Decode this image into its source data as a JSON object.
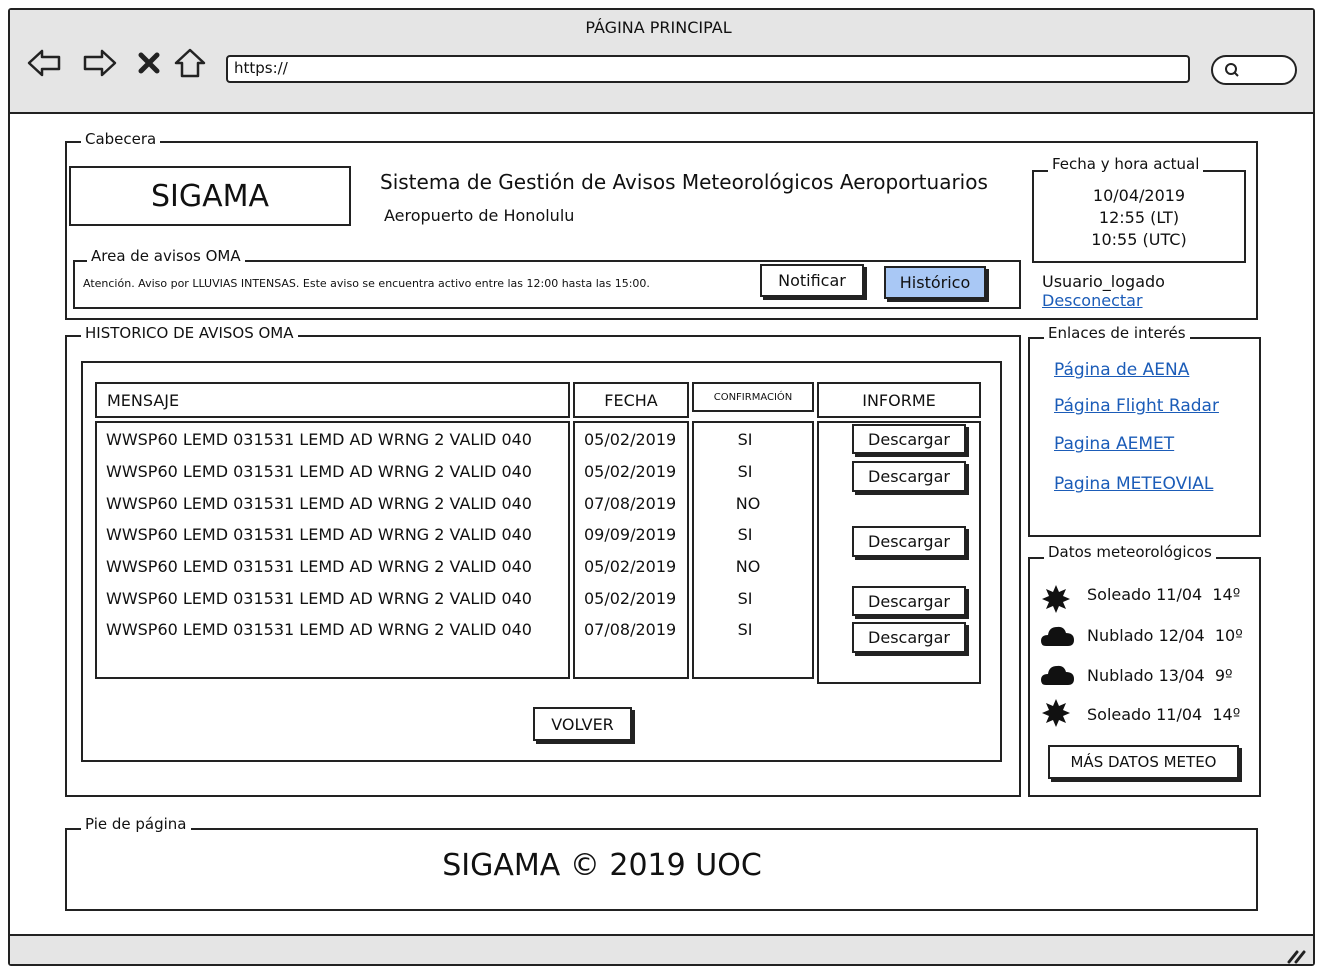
{
  "window": {
    "title": "PÁGINA PRINCIPAL",
    "url": "https://"
  },
  "header": {
    "group_label": "Cabecera",
    "logo_text": "SIGAMA",
    "system_title": "Sistema de Gestión de Avisos Meteorológicos Aeroportuarios",
    "airport": "Aeropuerto de Honolulu",
    "datetime": {
      "group_label": "Fecha y hora actual",
      "date": "10/04/2019",
      "time_lt": "12:55 (LT)",
      "time_utc": "10:55 (UTC)"
    },
    "user": "Usuario_logado",
    "logout_label": "Desconectar",
    "oma_area": {
      "group_label": "Area de avisos OMA",
      "alert_text": "Atención. Aviso por LLUVIAS INTENSAS. Este aviso se encuentra activo entre las 12:00 hasta las 15:00.",
      "notify_label": "Notificar",
      "history_label": "Histórico"
    }
  },
  "history": {
    "group_label": "HISTORICO DE AVISOS OMA",
    "columns": [
      "MENSAJE",
      "FECHA",
      "CONFIRMACIÓN",
      "INFORME"
    ],
    "rows": [
      {
        "mensaje": "WWSP60 LEMD 031531 LEMD AD WRNG 2 VALID 040",
        "fecha": "05/02/2019",
        "confirmacion": "SI",
        "informe": "Descargar"
      },
      {
        "mensaje": "WWSP60 LEMD 031531 LEMD AD WRNG 2 VALID 040",
        "fecha": "05/02/2019",
        "confirmacion": "SI",
        "informe": "Descargar"
      },
      {
        "mensaje": "WWSP60 LEMD 031531 LEMD AD WRNG 2 VALID 040",
        "fecha": "07/08/2019",
        "confirmacion": "NO",
        "informe": ""
      },
      {
        "mensaje": "WWSP60 LEMD 031531 LEMD AD WRNG 2 VALID 040",
        "fecha": "09/09/2019",
        "confirmacion": "SI",
        "informe": "Descargar"
      },
      {
        "mensaje": "WWSP60 LEMD 031531 LEMD AD WRNG 2 VALID 040",
        "fecha": "05/02/2019",
        "confirmacion": "NO",
        "informe": ""
      },
      {
        "mensaje": "WWSP60 LEMD 031531 LEMD AD WRNG 2 VALID 040",
        "fecha": "05/02/2019",
        "confirmacion": "SI",
        "informe": "Descargar"
      },
      {
        "mensaje": "WWSP60 LEMD 031531 LEMD AD WRNG 2 VALID 040",
        "fecha": "07/08/2019",
        "confirmacion": "SI",
        "informe": "Descargar"
      }
    ],
    "back_label": "VOLVER"
  },
  "links": {
    "group_label": "Enlaces de interés",
    "items": [
      "Página de AENA",
      "Página Flight Radar",
      "Pagina AEMET",
      "Pagina METEOVIAL"
    ]
  },
  "weather": {
    "group_label": "Datos meteorológicos",
    "items": [
      {
        "icon": "sun-icon",
        "desc": "Soleado",
        "date": "11/04",
        "temp": "14º"
      },
      {
        "icon": "cloud-icon",
        "desc": "Nublado",
        "date": "12/04",
        "temp": "10º"
      },
      {
        "icon": "cloud-icon",
        "desc": "Nublado",
        "date": "13/04",
        "temp": "9º"
      },
      {
        "icon": "sun-icon",
        "desc": "Soleado",
        "date": "11/04",
        "temp": "14º"
      }
    ],
    "more_label": "MÁS DATOS METEO"
  },
  "footer": {
    "group_label": "Pie de página",
    "text": "SIGAMA © 2019 UOC"
  },
  "colors": {
    "history_button_bg": "#a9c8f5",
    "link": "#1b5cb8",
    "chrome": "#e5e5e5"
  }
}
